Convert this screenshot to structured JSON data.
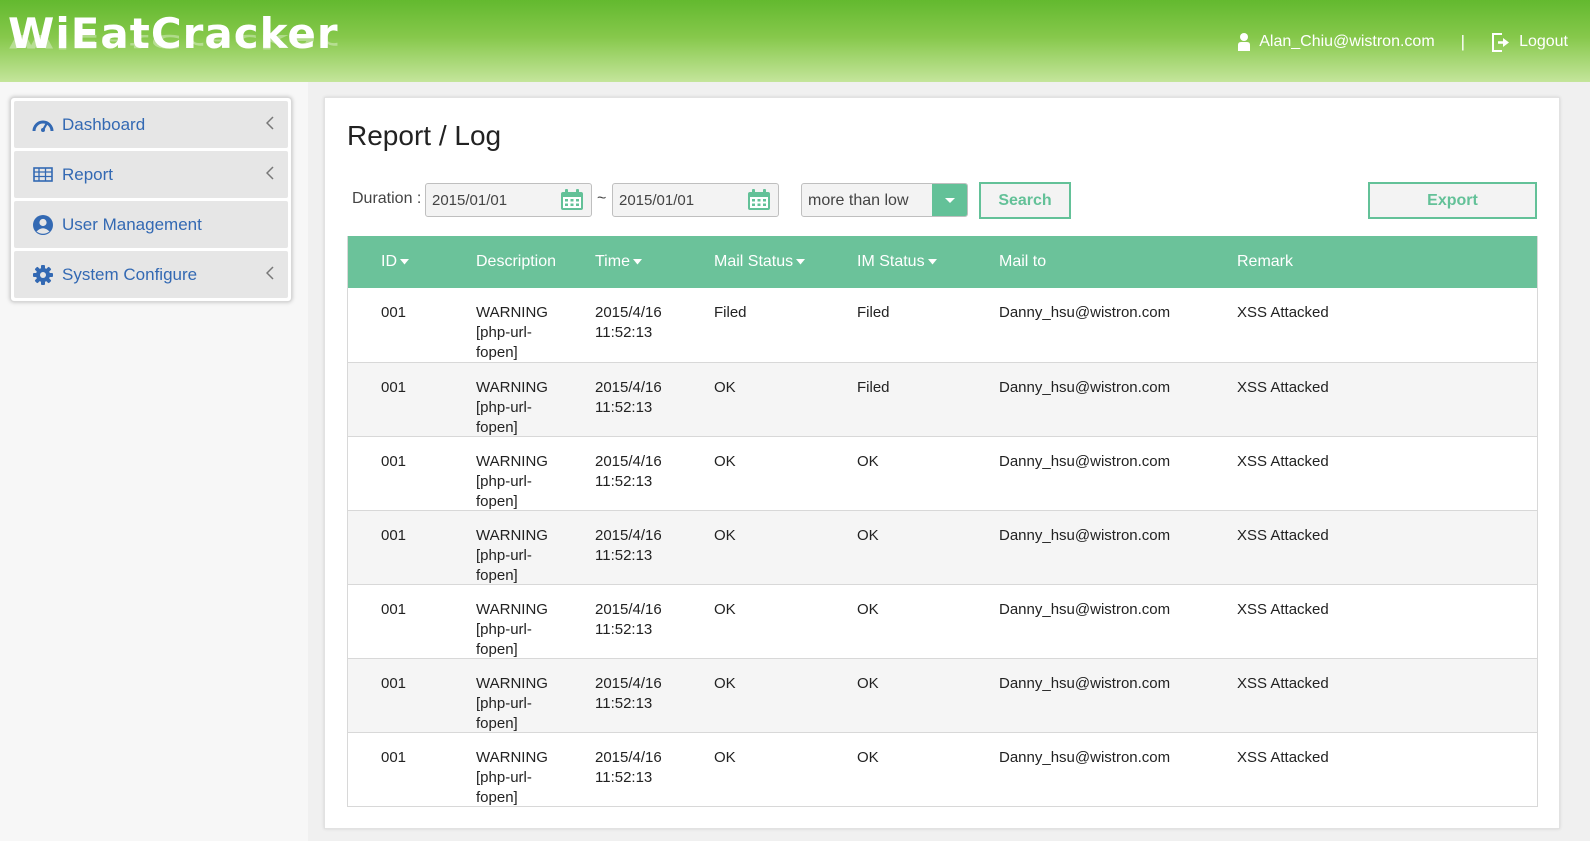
{
  "header": {
    "logo": "WiEatCracker",
    "user_email": "Alan_Chiu@wistron.com",
    "separator": "|",
    "logout_label": "Logout",
    "user_icon": "user-icon",
    "logout_icon": "logout-icon"
  },
  "sidebar": {
    "items": [
      {
        "label": "Dashboard",
        "icon": "dashboard-gauge-icon",
        "has_chevron": true
      },
      {
        "label": "Report",
        "icon": "table-icon",
        "has_chevron": true
      },
      {
        "label": "User Management",
        "icon": "user-circle-icon",
        "has_chevron": false
      },
      {
        "label": "System Configure",
        "icon": "gear-icon",
        "has_chevron": true
      }
    ]
  },
  "main": {
    "title": "Report / Log",
    "filters": {
      "duration_label": "Duration :",
      "date_from": "2015/01/01",
      "tilde": "~",
      "date_to": "2015/01/01",
      "severity": "more than low",
      "search_label": "Search",
      "export_label": "Export"
    },
    "table": {
      "columns": [
        "ID",
        "Description",
        "Time",
        "Mail Status",
        "IM Status",
        "Mail to",
        "Remark"
      ],
      "rows": [
        {
          "id": "001",
          "desc": [
            "WARNING",
            "[php-url-",
            "fopen]"
          ],
          "time": [
            "2015/4/16",
            "11:52:13"
          ],
          "mail_status": "Filed",
          "im_status": "Filed",
          "mail_to": "Danny_hsu@wistron.com",
          "remark": "XSS Attacked"
        },
        {
          "id": "001",
          "desc": [
            "WARNING",
            "[php-url-",
            "fopen]"
          ],
          "time": [
            "2015/4/16",
            "11:52:13"
          ],
          "mail_status": "OK",
          "im_status": "Filed",
          "mail_to": "Danny_hsu@wistron.com",
          "remark": "XSS Attacked"
        },
        {
          "id": "001",
          "desc": [
            "WARNING",
            "[php-url-",
            "fopen]"
          ],
          "time": [
            "2015/4/16",
            "11:52:13"
          ],
          "mail_status": "OK",
          "im_status": "OK",
          "mail_to": "Danny_hsu@wistron.com",
          "remark": "XSS Attacked"
        },
        {
          "id": "001",
          "desc": [
            "WARNING",
            "[php-url-",
            "fopen]"
          ],
          "time": [
            "2015/4/16",
            "11:52:13"
          ],
          "mail_status": "OK",
          "im_status": "OK",
          "mail_to": "Danny_hsu@wistron.com",
          "remark": "XSS Attacked"
        },
        {
          "id": "001",
          "desc": [
            "WARNING",
            "[php-url-",
            "fopen]"
          ],
          "time": [
            "2015/4/16",
            "11:52:13"
          ],
          "mail_status": "OK",
          "im_status": "OK",
          "mail_to": "Danny_hsu@wistron.com",
          "remark": "XSS Attacked"
        },
        {
          "id": "001",
          "desc": [
            "WARNING",
            "[php-url-",
            "fopen]"
          ],
          "time": [
            "2015/4/16",
            "11:52:13"
          ],
          "mail_status": "OK",
          "im_status": "OK",
          "mail_to": "Danny_hsu@wistron.com",
          "remark": "XSS Attacked"
        },
        {
          "id": "001",
          "desc": [
            "WARNING",
            "[php-url-",
            "fopen]"
          ],
          "time": [
            "2015/4/16",
            "11:52:13"
          ],
          "mail_status": "OK",
          "im_status": "OK",
          "mail_to": "Danny_hsu@wistron.com",
          "remark": "XSS Attacked"
        }
      ]
    }
  },
  "colors": {
    "header_green": "#63b92f",
    "accent": "#63c198",
    "nav_text": "#3369b3"
  }
}
